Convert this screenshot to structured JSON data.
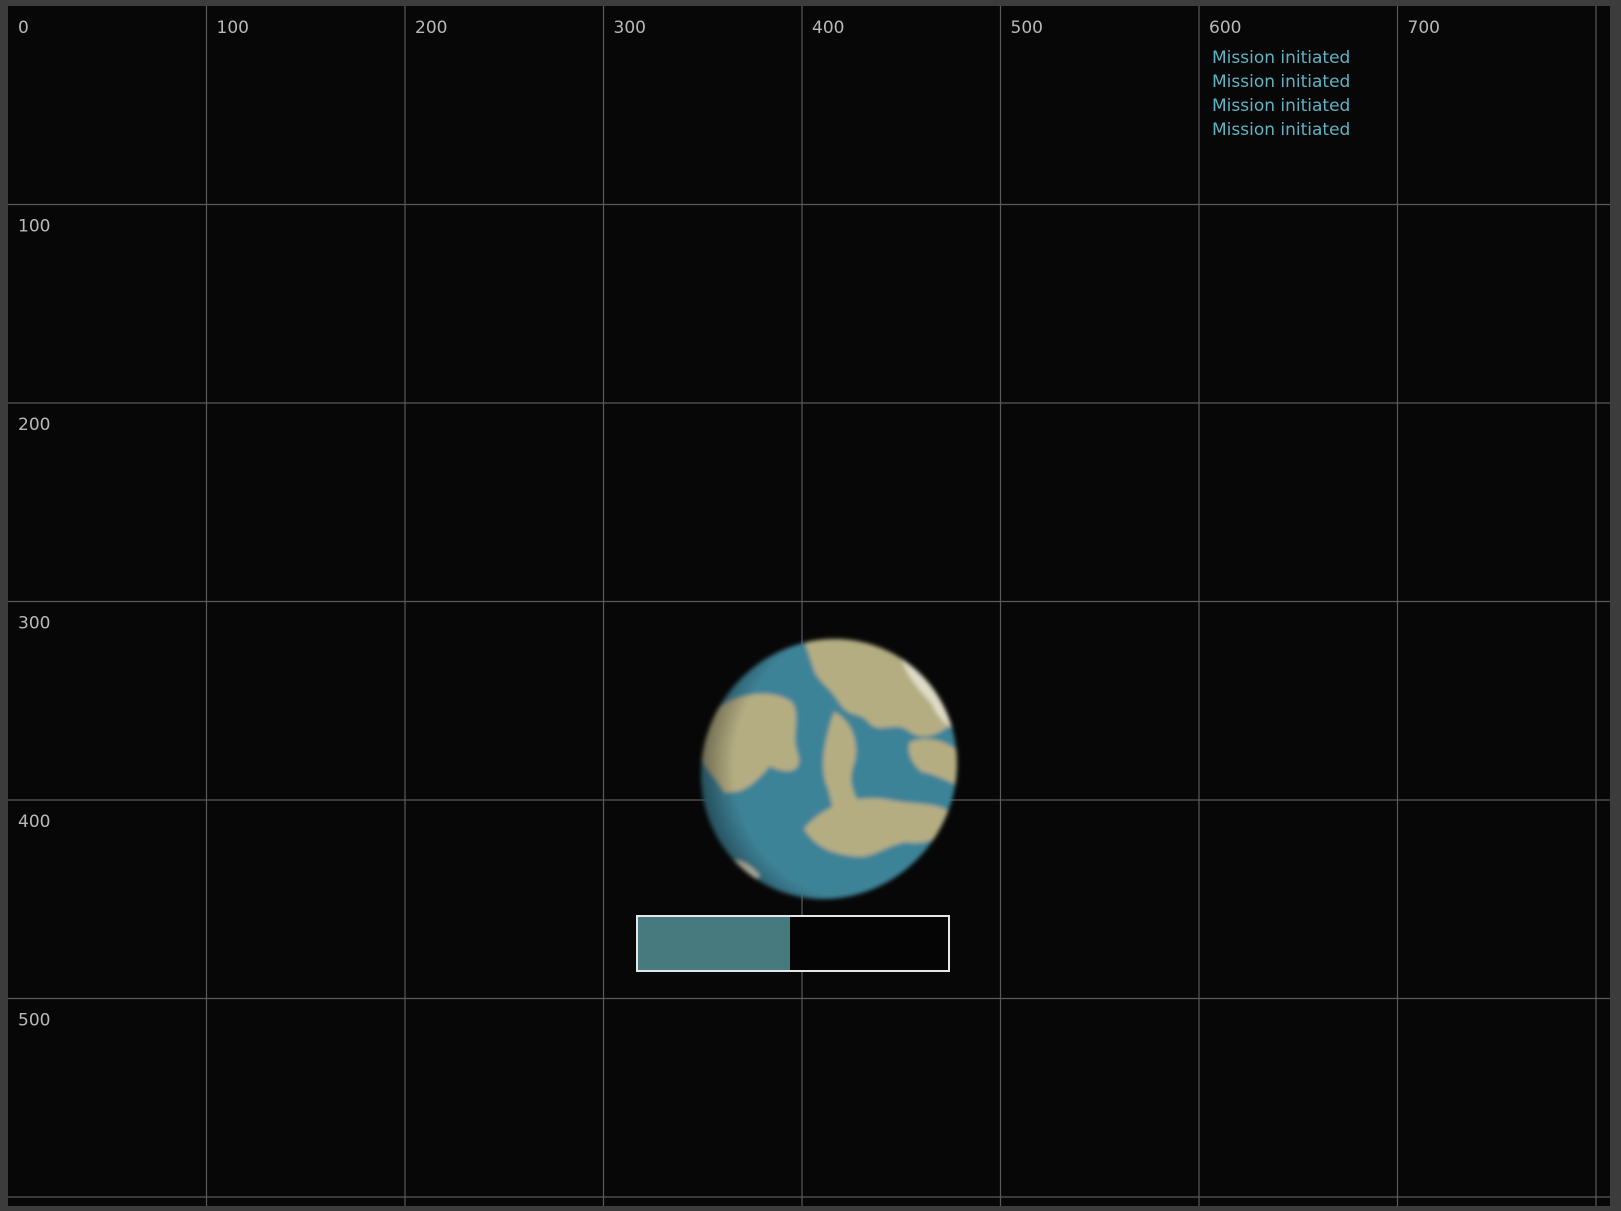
{
  "grid": {
    "x_labels": [
      "0",
      "100",
      "200",
      "300",
      "400",
      "500",
      "600",
      "700"
    ],
    "y_labels": [
      "100",
      "200",
      "300",
      "400",
      "500"
    ]
  },
  "log": {
    "color": "#5fb3c4",
    "lines": [
      "Mission initiated",
      "Mission initiated",
      "Mission initiated",
      "Mission initiated"
    ]
  },
  "planet": {
    "icon": "earth-planet-icon",
    "ocean_color": "#3e8397",
    "land_color": "#b4ad82",
    "ice_color": "#dedcc6"
  },
  "progress": {
    "fraction": 0.49,
    "fill_color": "#477a7f",
    "border_color": "#e6e6e6"
  }
}
